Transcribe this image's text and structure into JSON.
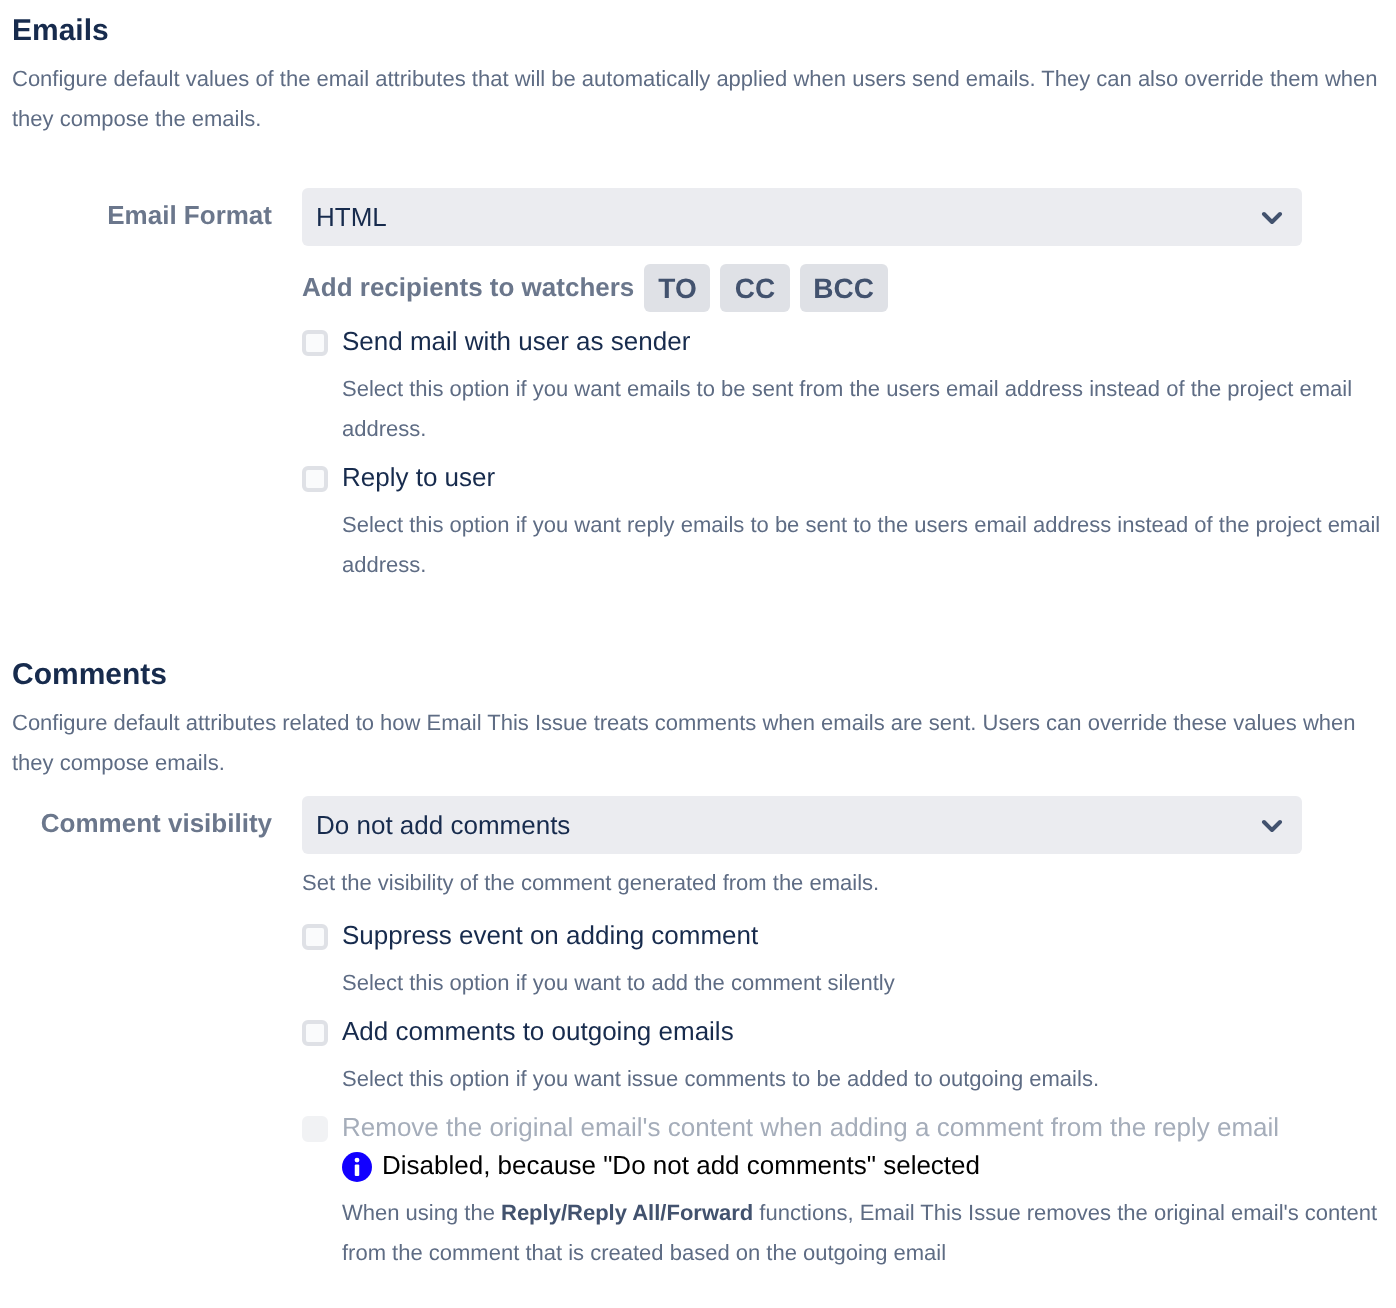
{
  "emails": {
    "title": "Emails",
    "description": "Configure default values of the email attributes that will be automatically applied when users send emails. They can also override them when they compose the emails.",
    "email_format": {
      "label": "Email Format",
      "value": "HTML"
    },
    "watchers": {
      "label": "Add recipients to watchers",
      "buttons": [
        "TO",
        "CC",
        "BCC"
      ]
    },
    "options": [
      {
        "label": "Send mail with user as sender",
        "checked": false,
        "disabled": false,
        "help": "Select this option if you want emails to be sent from the users email address instead of the project email address."
      },
      {
        "label": "Reply to user",
        "checked": false,
        "disabled": false,
        "help": "Select this option if you want reply emails to be sent to the users email address instead of the project email address."
      }
    ]
  },
  "comments": {
    "title": "Comments",
    "description": "Configure default attributes related to how Email This Issue treats comments when emails are sent. Users can override these values when they compose emails.",
    "comment_visibility": {
      "label": "Comment visibility",
      "value": "Do not add comments",
      "help": "Set the visibility of the comment generated from the emails."
    },
    "options": [
      {
        "label": "Suppress event on adding comment",
        "checked": false,
        "disabled": false,
        "help": "Select this option if you want to add the comment silently"
      },
      {
        "label": "Add comments to outgoing emails",
        "checked": false,
        "disabled": false,
        "help": "Select this option if you want issue comments to be added to outgoing emails."
      },
      {
        "label": "Remove the original email's content when adding a comment from the reply email",
        "checked": false,
        "disabled": true,
        "notice": "Disabled, because \"Do not add comments\" selected",
        "help": "When using the **Reply/Reply All/Forward** functions, Email This Issue removes the original email's content from the comment that is created based on the outgoing email"
      }
    ]
  }
}
